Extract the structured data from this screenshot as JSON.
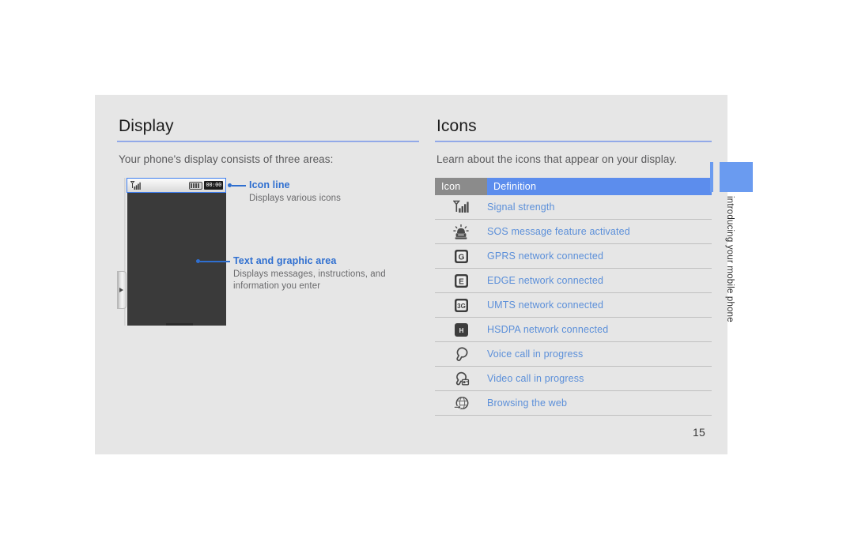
{
  "page": {
    "number": "15",
    "margin_tab_label": "introducing your mobile phone",
    "tab_color": "#6a9bf0",
    "sheet_color": "#e6e6e6"
  },
  "left_section": {
    "title": "Display",
    "intro": "Your phone's display consists of three areas:",
    "statusbar": {
      "signal_icon": "signal-strength-icon",
      "battery_icon": "battery-icon",
      "clock": "00:00"
    },
    "callouts": [
      {
        "title": "Icon line",
        "description": "Displays various icons"
      },
      {
        "title": "Text and graphic area",
        "description": "Displays messages, instructions, and information you enter"
      }
    ]
  },
  "right_section": {
    "title": "Icons",
    "intro": "Learn about the icons that appear on your display.",
    "table": {
      "headers": {
        "icon": "Icon",
        "definition": "Definition"
      },
      "header_icon_color": "#8b8b8b",
      "header_definition_color": "#5c8ded",
      "definition_text_color": "#5b8fd9",
      "rows": [
        {
          "icon": "signal-strength-icon",
          "definition": "Signal strength"
        },
        {
          "icon": "sos-beacon-icon",
          "definition": "SOS message feature activated"
        },
        {
          "icon": "gprs-badge-icon",
          "badge": "G",
          "definition": "GPRS network connected"
        },
        {
          "icon": "edge-badge-icon",
          "badge": "E",
          "definition": "EDGE network connected"
        },
        {
          "icon": "umts-badge-icon",
          "badge": "3G",
          "definition": "UMTS network connected"
        },
        {
          "icon": "hsdpa-badge-icon",
          "badge": "H",
          "definition": "HSDPA network connected"
        },
        {
          "icon": "voice-call-icon",
          "definition": "Voice call in progress"
        },
        {
          "icon": "video-call-icon",
          "definition": "Video call in progress"
        },
        {
          "icon": "browsing-web-icon",
          "definition": "Browsing the web"
        }
      ]
    }
  }
}
